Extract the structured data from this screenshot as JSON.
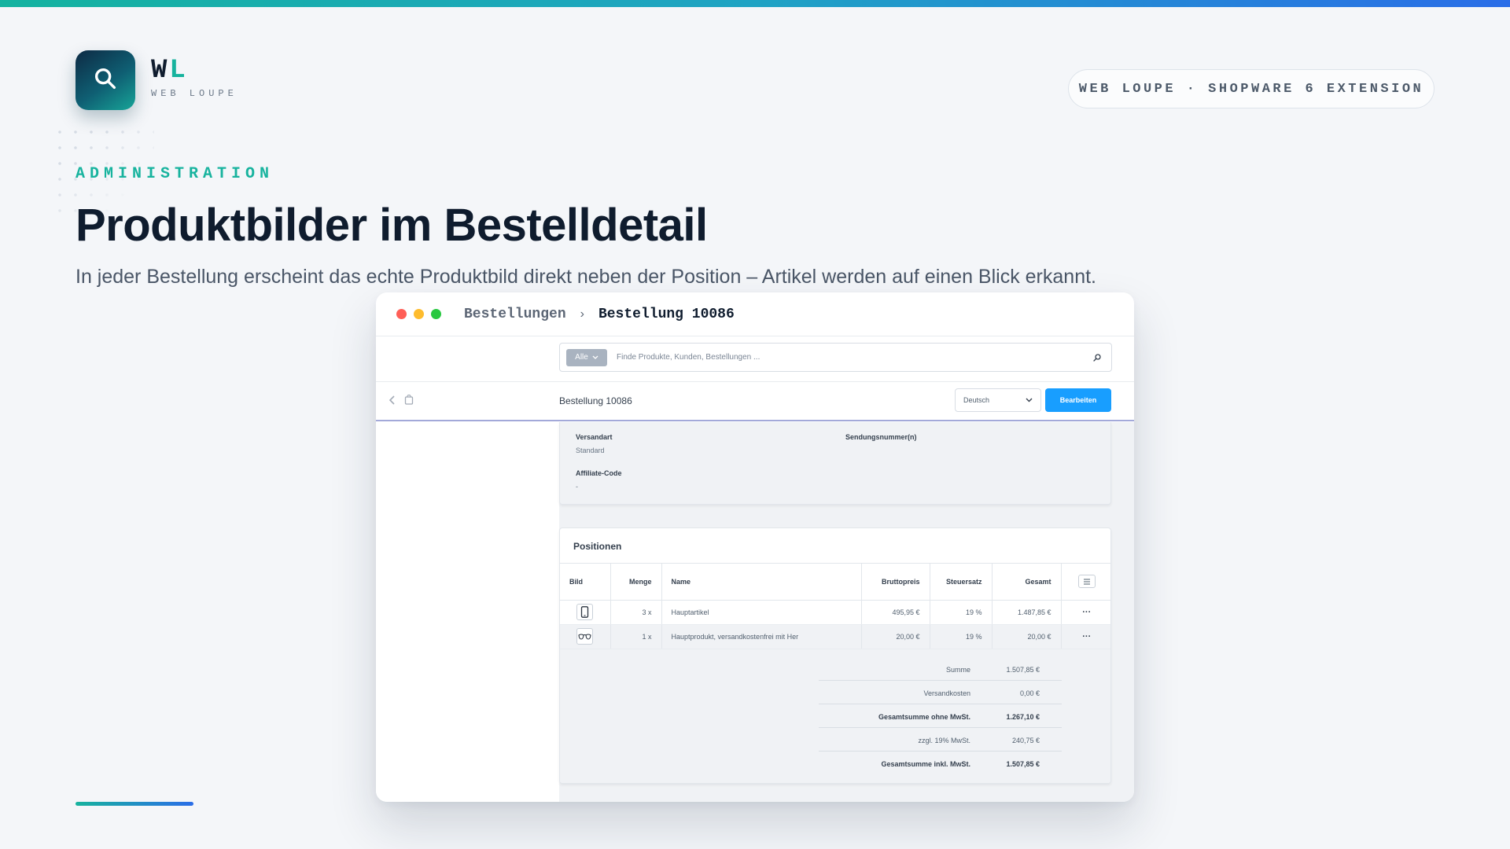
{
  "brand": {
    "logo_letter_w": "W",
    "logo_letter_l": "L",
    "logo_subtitle": "WEB LOUPE",
    "logo_icon": "search-icon",
    "accent_color": "#17b39e",
    "pill_text": "WEB LOUPE · SHOPWARE 6 EXTENSION"
  },
  "hero": {
    "eyebrow": "ADMINISTRATION",
    "headline": "Produktbilder im Bestelldetail",
    "subline": "In jeder Bestellung erscheint das echte Produktbild direkt neben der Position – Artikel werden auf einen Blick erkannt."
  },
  "window": {
    "breadcrumb_parent": "Bestellungen",
    "breadcrumb_separator": "›",
    "breadcrumb_current": "Bestellung 10086"
  },
  "admin": {
    "search": {
      "filter_label": "Alle",
      "placeholder": "Finde Produkte, Kunden, Bestellungen ..."
    },
    "smartbar": {
      "title": "Bestellung 10086",
      "language": "Deutsch",
      "edit_label": "Bearbeiten",
      "primary_color": "#189eff"
    },
    "details": {
      "shipping_label": "Versandart",
      "shipping_value": "Standard",
      "tracking_label": "Sendungsnummer(n)",
      "affiliate_label": "Affiliate-Code",
      "affiliate_value": "-"
    },
    "positions": {
      "title": "Positionen",
      "columns": [
        "Bild",
        "Menge",
        "Name",
        "Bruttopreis",
        "Steuersatz",
        "Gesamt"
      ],
      "rows": [
        {
          "image_icon": "smartphone-icon",
          "qty": "3 x",
          "name": "Hauptartikel",
          "price": "495,95 €",
          "tax": "19 %",
          "total": "1.487,85 €",
          "menu": "···"
        },
        {
          "image_icon": "glasses-icon",
          "qty": "1 x",
          "name": "Hauptprodukt, versandkostenfrei mit Her",
          "price": "20,00 €",
          "tax": "19 %",
          "total": "20,00 €",
          "menu": "···"
        }
      ],
      "summary": [
        {
          "label": "Summe",
          "value": "1.507,85 €"
        },
        {
          "label": "Versandkosten",
          "value": "0,00 €"
        },
        {
          "label": "Gesamtsumme ohne MwSt.",
          "value": "1.267,10 €"
        },
        {
          "label": "zzgl. 19% MwSt.",
          "value": "240,75 €"
        },
        {
          "label": "Gesamtsumme inkl. MwSt.",
          "value": "1.507,85 €"
        }
      ]
    }
  }
}
